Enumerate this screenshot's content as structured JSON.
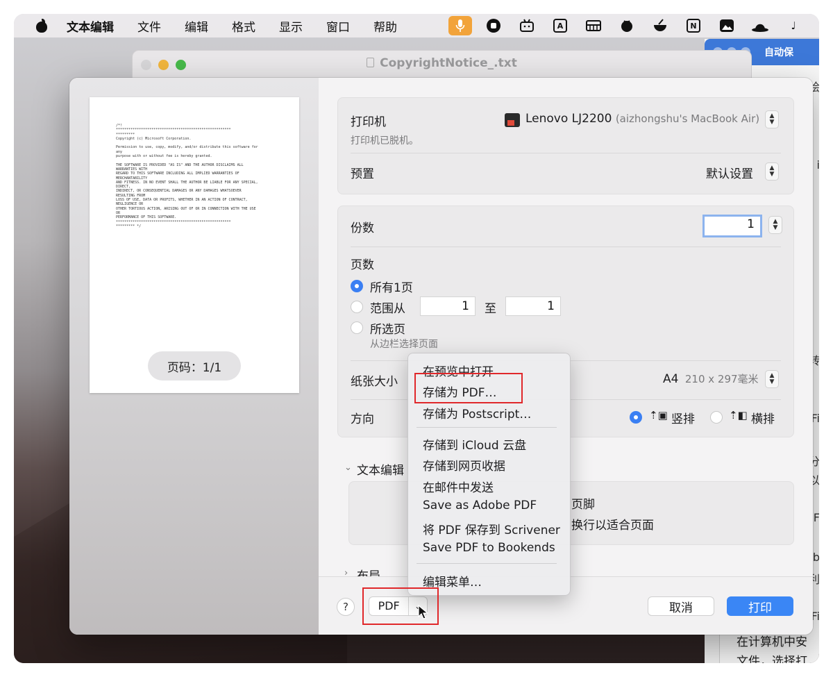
{
  "menubar": {
    "app_name": "文本编辑",
    "items": [
      "文件",
      "编辑",
      "格式",
      "显示",
      "窗口",
      "帮助"
    ],
    "status_icons": [
      "microphone-icon",
      "record-icon",
      "bilibili-icon",
      "translate-icon",
      "menubar-tool-icon",
      "tomato-icon",
      "bowl-icon",
      "notion-icon",
      "photo-icon",
      "hat-icon"
    ],
    "notion_glyph": "N",
    "translate_glyph": "A",
    "tail_glyph": "♩"
  },
  "background_window": {
    "title": "CopyrightNotice_.txt"
  },
  "right_window": {
    "title": "自动保",
    "fragments": [
      "一绘",
      "i",
      "转",
      "Fi",
      "分",
      "以",
      "F",
      "b",
      "利",
      "Fi"
    ],
    "bottom_lines": [
      "在计算机中安",
      "文件，选择打"
    ]
  },
  "preview": {
    "page_text": "/*!\n*******************************************************\n*********\nCopyright (c) Microsoft Corporation.\n\nPermission to use, copy, modify, and/or distribute this software for\nany\npurpose with or without fee is hereby granted.\n\nTHE SOFTWARE IS PROVIDED \"AS IS\" AND THE AUTHOR DISCLAIMS ALL\nWARRANTIES WITH\nREGARD TO THIS SOFTWARE INCLUDING ALL IMPLIED WARRANTIES OF\nMERCHANTABILITY\nAND FITNESS. IN NO EVENT SHALL THE AUTHOR BE LIABLE FOR ANY SPECIAL,\nDIRECT,\nINDIRECT, OR CONSEQUENTIAL DAMAGES OR ANY DAMAGES WHATSOEVER\nRESULTING FROM\nLOSS OF USE, DATA OR PROFITS, WHETHER IN AN ACTION OF CONTRACT,\nNEGLIGENCE OR\nOTHER TORTIOUS ACTION, ARISING OUT OF OR IN CONNECTION WITH THE USE\nOR\nPERFORMANCE OF THIS SOFTWARE.\n*******************************************************\n********* */",
    "page_badge": "页码：1/1"
  },
  "printer": {
    "label": "打印机",
    "name": "Lenovo LJ2200",
    "host": "(aizhongshu's MacBook Air)",
    "status": "打印机已脱机。",
    "preset_label": "预置",
    "preset_value": "默认设置"
  },
  "copies": {
    "label": "份数",
    "value": "1"
  },
  "pages": {
    "label": "页数",
    "all": "所有1页",
    "range": "范围从",
    "from": "1",
    "to_label": "至",
    "to": "1",
    "selected": "所选页",
    "selected_hint": "从边栏选择页面"
  },
  "paper": {
    "label": "纸张大小",
    "value": "A4",
    "dims": "210 x 297毫米",
    "orientation_label": "方向",
    "portrait": "竖排",
    "landscape": "横排"
  },
  "textedit_section": {
    "label": "文本编辑",
    "option1_tail": "页脚",
    "option2_tail": "换行以适合页面"
  },
  "layout_section": {
    "label": "布局"
  },
  "footer": {
    "help": "?",
    "pdf": "PDF",
    "cancel": "取消",
    "print": "打印"
  },
  "pdf_menu": {
    "items": [
      "在预览中打开",
      "存储为 PDF…",
      "存储为 Postscript…",
      "存储到 iCloud 云盘",
      "存储到网页收据",
      "在邮件中发送",
      "Save as Adobe PDF",
      "将 PDF 保存到 Scrivener",
      "Save PDF to Bookends",
      "编辑菜单…"
    ]
  },
  "colors": {
    "accent": "#3a86f5",
    "highlight": "#e0272a",
    "mic_bg": "#f2a33a"
  }
}
